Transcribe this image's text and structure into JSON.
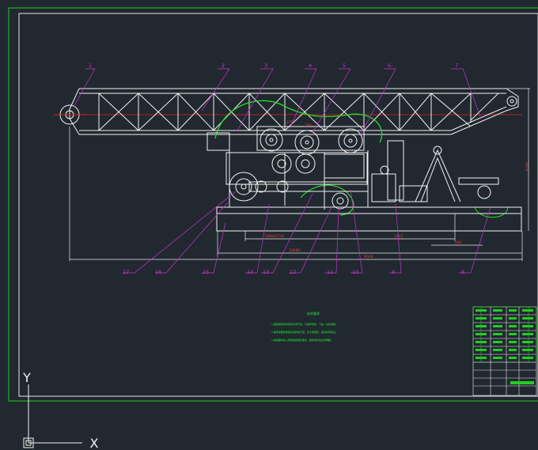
{
  "drawing": {
    "balloons": [
      "1",
      "2",
      "3",
      "4",
      "5",
      "6",
      "7",
      "17",
      "16",
      "15",
      "14",
      "13",
      "12",
      "11",
      "10",
      "9",
      "8"
    ],
    "dimensions": {
      "height_right": "3070",
      "dim_a": "1880/2750",
      "dim_b": "1425",
      "dim_c": "10680",
      "dim_d": "9048",
      "dim_e": "444",
      "small_top_a": "270",
      "small_top_b": "370"
    },
    "notes_title": "技术要求",
    "notes_lines": [
      "1.装配前所有零件应清洗干净，不得有毛刺、飞边、氧化皮等。",
      "2.各传动部件装配后应转动灵活，无卡滞现象，链条松紧适当。",
      "3.减速器内注入润滑油至规定油位，各润滑点加注润滑脂。"
    ],
    "ucs": {
      "x_label": "X",
      "y_label": "Y"
    }
  },
  "colors": {
    "background": "#212830",
    "frame_outer": "#22cc22",
    "frame_inner": "#e8e8e8",
    "geometry": "#f2f2f2",
    "leader": "#cc33cc",
    "red_axis": "#e02020",
    "green_guard": "#22dd22",
    "notes": "#22ff22"
  }
}
